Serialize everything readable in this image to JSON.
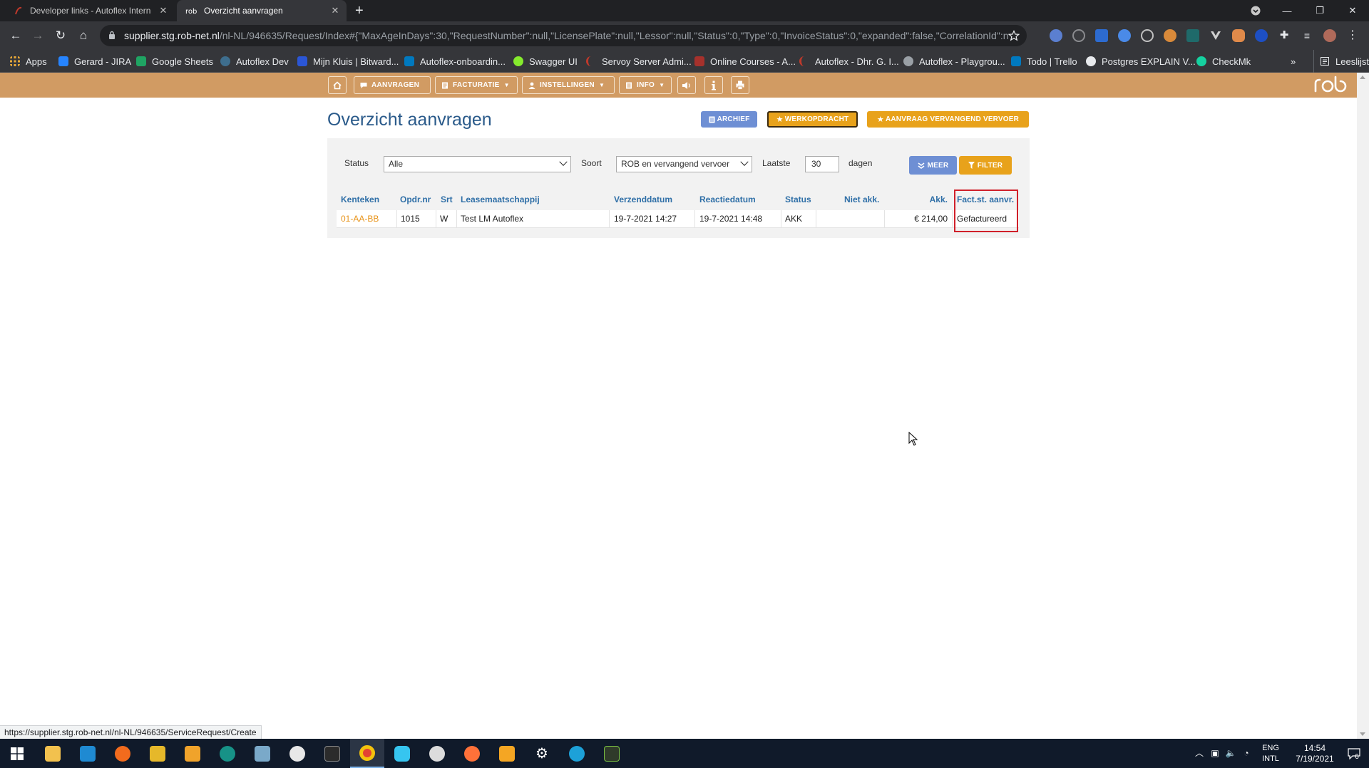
{
  "browser": {
    "tabs": [
      {
        "title": "Developer links - Autoflex Intern",
        "active": false
      },
      {
        "title": "Overzicht aanvragen",
        "active": true
      }
    ],
    "url_host": "supplier.stg.rob-net.nl",
    "url_path": "/nl-NL/946635/Request/Index#{\"MaxAgeInDays\":30,\"RequestNumber\":null,\"LicensePlate\":null,\"Lessor\":null,\"Status\":0,\"Type\":0,\"InvoiceStatus\":0,\"expanded\":false,\"CorrelationId\":null...",
    "bookmarks": [
      {
        "label": "Apps",
        "icon": "apps-grid-icon"
      },
      {
        "label": "Gerard - JIRA",
        "icon": "jira-icon"
      },
      {
        "label": "Google Sheets",
        "icon": "sheets-icon"
      },
      {
        "label": "Autoflex Dev",
        "icon": "autoflex-icon"
      },
      {
        "label": "Mijn Kluis | Bitward...",
        "icon": "bitwarden-icon"
      },
      {
        "label": "Autoflex-onboardin...",
        "icon": "trello-icon"
      },
      {
        "label": "Swagger UI",
        "icon": "swagger-icon"
      },
      {
        "label": "Servoy Server Admi...",
        "icon": "servoy-icon"
      },
      {
        "label": "Online Courses - A...",
        "icon": "courses-icon"
      },
      {
        "label": "Autoflex - Dhr. G. I...",
        "icon": "autoflex-red-icon"
      },
      {
        "label": "Autoflex - Playgrou...",
        "icon": "playground-icon"
      },
      {
        "label": "Todo | Trello",
        "icon": "trello-icon"
      },
      {
        "label": "Postgres EXPLAIN V...",
        "icon": "postgres-icon"
      },
      {
        "label": "CheckMk",
        "icon": "checkmk-icon"
      }
    ],
    "bookmarks_overflow": "»",
    "reading_list": "Leeslijst",
    "status_bar_url": "https://supplier.stg.rob-net.nl/nl-NL/946635/ServiceRequest/Create"
  },
  "app": {
    "nav": {
      "aanvragen": "AANVRAGEN",
      "facturatie": "FACTURATIE",
      "instellingen": "INSTELLINGEN",
      "info": "INFO"
    },
    "logo_text": "rob",
    "page_title": "Overzicht aanvragen",
    "header_buttons": {
      "archief": "ARCHIEF",
      "werkopdracht": "WERKOPDRACHT",
      "vervangend": "AANVRAAG VERVANGEND VERVOER"
    },
    "filters": {
      "status_label": "Status",
      "status_value": "Alle",
      "soort_label": "Soort",
      "soort_value": "ROB en vervangend vervoer",
      "laatste_label": "Laatste",
      "laatste_value": "30",
      "dagen_label": "dagen",
      "meer": "MEER",
      "filter": "FILTER"
    },
    "table": {
      "headers": {
        "kenteken": "Kenteken",
        "opdrnr": "Opdr.nr",
        "srt": "Srt",
        "leasemaatschappij": "Leasemaatschappij",
        "verzenddatum": "Verzenddatum",
        "reactiedatum": "Reactiedatum",
        "status": "Status",
        "nietakk": "Niet akk.",
        "akk": "Akk.",
        "factst": "Fact.st. aanvr."
      },
      "rows": [
        {
          "kenteken": "01-AA-BB",
          "opdrnr": "1015",
          "srt": "W",
          "leasemaatschappij": "Test LM Autoflex",
          "verzenddatum": "19-7-2021 14:27",
          "reactiedatum": "19-7-2021 14:48",
          "status": "AKK",
          "nietakk": "",
          "akk": "€ 214,00",
          "factst": "Gefactureerd"
        }
      ]
    }
  },
  "taskbar": {
    "lang_top": "ENG",
    "lang_bottom": "INTL",
    "time": "14:54",
    "date": "7/19/2021",
    "notifications": "6"
  },
  "colors": {
    "nav_bg": "#d19b63",
    "title_blue": "#2a5a8a",
    "header_blue": "#2f6fa7",
    "orange": "#e8a21b",
    "archief_blue": "#6e8fd4",
    "highlight_red": "#d0202a"
  }
}
